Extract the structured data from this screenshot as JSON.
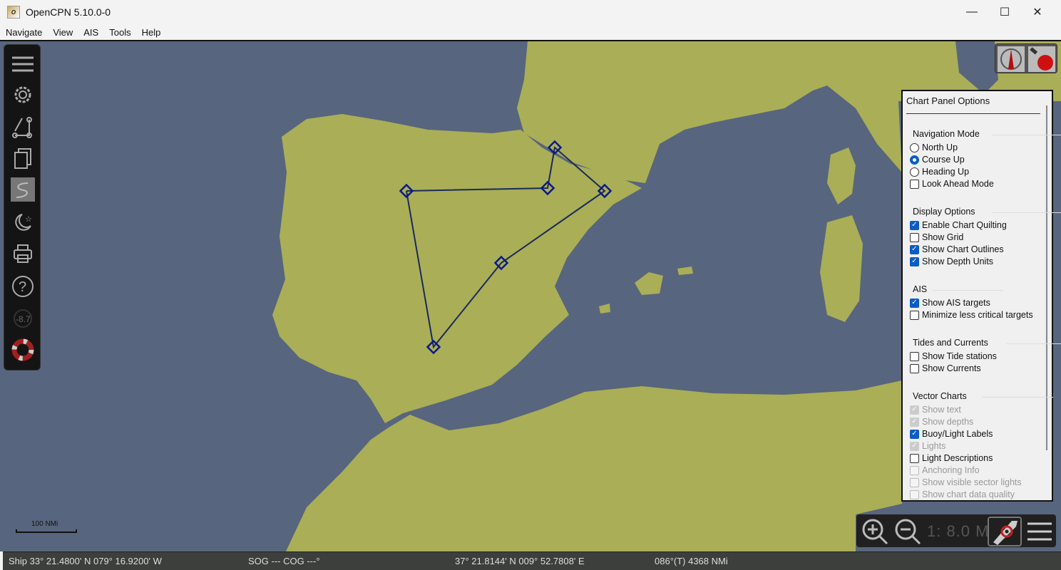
{
  "window": {
    "title": "OpenCPN 5.10.0-0",
    "minimize": "—",
    "maximize": "☐",
    "close": "✕"
  },
  "menu": [
    "Navigate",
    "View",
    "AIS",
    "Tools",
    "Help"
  ],
  "colors": {
    "land": "#aaae56",
    "sea": "#58657e",
    "route": "#1a2a5a",
    "waypoint": "#0a1a8a"
  },
  "toolbar": [
    "menu-icon",
    "settings-icon",
    "route-icon",
    "document-icon",
    "track-icon",
    "night-mode-icon",
    "print-icon",
    "help-icon",
    "tide-current-icon",
    "mob-icon"
  ],
  "toolbar_tide_label": "-8.7",
  "scale_label": "100 NMi",
  "panel": {
    "title": "Chart Panel Options",
    "groups": [
      {
        "title": "Navigation Mode",
        "items": [
          {
            "type": "radio",
            "label": "North Up",
            "checked": false
          },
          {
            "type": "radio",
            "label": "Course Up",
            "checked": true
          },
          {
            "type": "radio",
            "label": "Heading Up",
            "checked": false
          },
          {
            "type": "check",
            "label": "Look Ahead Mode",
            "checked": false
          }
        ]
      },
      {
        "title": "Display Options",
        "items": [
          {
            "type": "check",
            "label": "Enable Chart Quilting",
            "checked": true
          },
          {
            "type": "check",
            "label": "Show Grid",
            "checked": false
          },
          {
            "type": "check",
            "label": "Show Chart Outlines",
            "checked": true
          },
          {
            "type": "check",
            "label": "Show Depth Units",
            "checked": true
          }
        ]
      },
      {
        "title": "AIS",
        "items": [
          {
            "type": "check",
            "label": "Show AIS targets",
            "checked": true
          },
          {
            "type": "check",
            "label": "Minimize less critical targets",
            "checked": false
          }
        ]
      },
      {
        "title": "Tides and Currents",
        "items": [
          {
            "type": "check",
            "label": "Show Tide stations",
            "checked": false
          },
          {
            "type": "check",
            "label": "Show Currents",
            "checked": false
          }
        ]
      },
      {
        "title": "Vector Charts",
        "items": [
          {
            "type": "check",
            "label": "Show text",
            "checked": true,
            "disabled": true
          },
          {
            "type": "check",
            "label": "Show depths",
            "checked": true,
            "disabled": true
          },
          {
            "type": "check",
            "label": "Buoy/Light Labels",
            "checked": true
          },
          {
            "type": "check",
            "label": "Lights",
            "checked": true,
            "disabled": true
          },
          {
            "type": "check",
            "label": "Light Descriptions",
            "checked": false
          },
          {
            "type": "check",
            "label": "Anchoring Info",
            "checked": false,
            "disabled": true
          },
          {
            "type": "check",
            "label": "Show visible sector lights",
            "checked": false,
            "disabled": true
          },
          {
            "type": "check",
            "label": "Show chart data quality",
            "checked": false,
            "disabled": true
          }
        ]
      }
    ]
  },
  "zoombar": {
    "scale": "1: 8.0 M"
  },
  "status": {
    "ship": "Ship 33° 21.4800' N   079° 16.9200' W",
    "sogcog": "SOG --- COG ---°",
    "cursor": "37° 21.8144' N   009° 52.7808' E",
    "bearing": "086°(T)  4368 NMi"
  }
}
